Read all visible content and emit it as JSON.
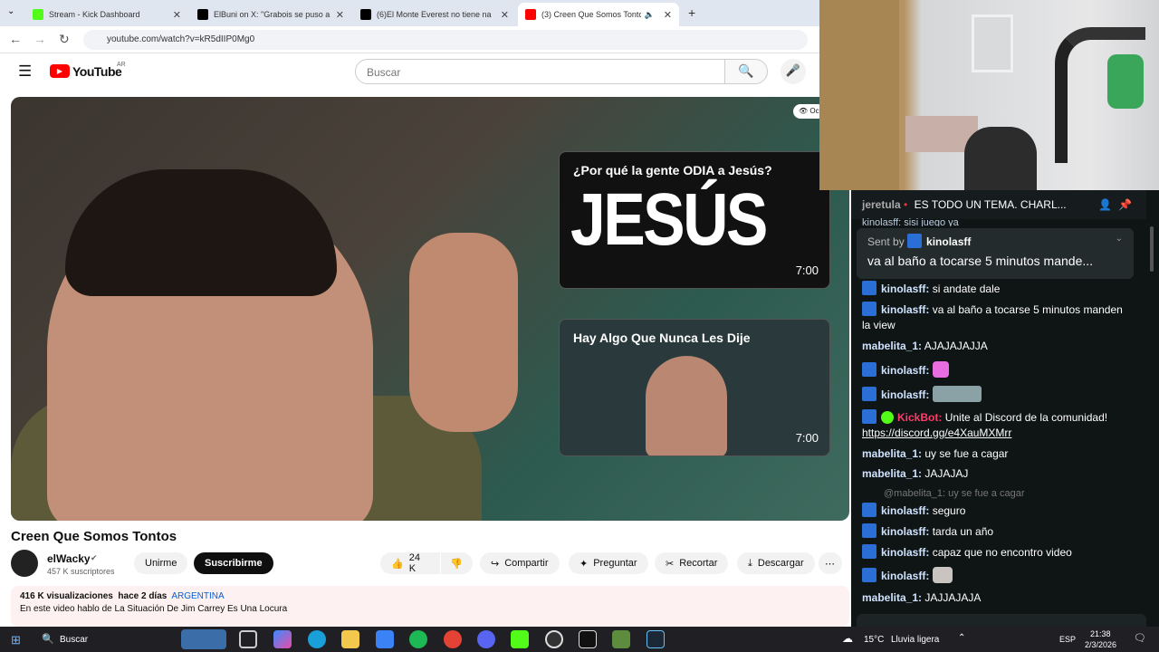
{
  "tabs": [
    {
      "title": "Stream - Kick Dashboard",
      "color": "#53fc18"
    },
    {
      "title": "ElBuni on X: \"Grabois se puso a",
      "color": "#000000"
    },
    {
      "title": "(6)El Monte Everest no tiene na",
      "color": "#000000"
    },
    {
      "title": "(3) Creen Que Somos Tonto",
      "color": "#ff0000"
    }
  ],
  "address": {
    "url": "youtube.com/watch?v=kR5dIIP0Mg0"
  },
  "youtube": {
    "logo": "YouTube",
    "region": "AR",
    "search_placeholder": "Buscar",
    "video_title": "Creen Que Somos Tontos",
    "channel": "elWacky",
    "subscribers": "457 K suscriptores",
    "join": "Unirme",
    "subscribe": "Suscribirme",
    "likes": "24 K",
    "share": "Compartir",
    "ask": "Preguntar",
    "clip": "Recortar",
    "download": "Descargar",
    "views": "416 K visualizaciones",
    "date": "hace 2 días",
    "country": "ARGENTINA",
    "description": "En este video hablo de La Situación De Jim Carrey Es Una Locura",
    "badge": "Oc",
    "cards": [
      {
        "title": "¿Por qué la gente ODIA a Jesús?",
        "big": "JESÚS",
        "duration": "7:00"
      },
      {
        "title": "Hay Algo Que Nunca Les Dije",
        "duration": "7:00"
      }
    ]
  },
  "chat": {
    "pinned_user": "jeretula",
    "pinned_text": "ES TODO UN TEMA. CHARL...",
    "reply_partial": "kinolasff: sisi juego ya",
    "sent_by_label": "Sent by",
    "sent_by_user": "kinolasff",
    "sent_text": "va al baño a tocarse 5 minutos mande...",
    "messages": [
      {
        "user": "kinolasff:",
        "text": "si andate dale"
      },
      {
        "user": "kinolasff:",
        "text": "va al baño a tocarse 5 minutos manden la view"
      },
      {
        "user": "mabelita_1:",
        "text": "AJAJAJAJJA"
      },
      {
        "user": "kinolasff:",
        "text": ""
      },
      {
        "user": "kinolasff:",
        "text": ""
      },
      {
        "user": "KickBot:",
        "text": "Unite al Discord de la comunidad!"
      },
      {
        "user": "",
        "text": "https://discord.gg/e4XauMXMrr"
      },
      {
        "user": "mabelita_1:",
        "text": "uy se fue a cagar"
      },
      {
        "user": "mabelita_1:",
        "text": "JAJAJAJ"
      },
      {
        "user": "",
        "text": "@mabelita_1: uy se fue a cagar"
      },
      {
        "user": "kinolasff:",
        "text": "seguro"
      },
      {
        "user": "kinolasff:",
        "text": "tarda un año"
      },
      {
        "user": "kinolasff:",
        "text": "capaz que no encontro video"
      },
      {
        "user": "kinolasff:",
        "text": ""
      },
      {
        "user": "mabelita_1:",
        "text": "JAJJAJAJA"
      }
    ]
  },
  "taskbar": {
    "search": "Buscar",
    "weather": "15°C",
    "weather_desc": "Lluvia ligera",
    "lang": "ESP",
    "time": "21:38",
    "date": "2/3/2026"
  }
}
